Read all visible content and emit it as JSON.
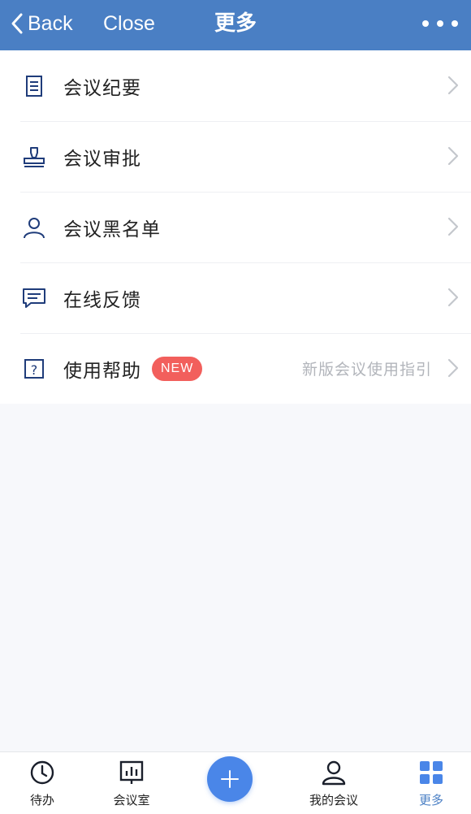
{
  "header": {
    "back_label": "Back",
    "close_label": "Close",
    "title": "更多",
    "more_icon": "more-dots-icon"
  },
  "menu": {
    "items": [
      {
        "label": "会议纪要",
        "icon": "document-icon"
      },
      {
        "label": "会议审批",
        "icon": "stamp-icon"
      },
      {
        "label": "会议黑名单",
        "icon": "user-icon"
      },
      {
        "label": "在线反馈",
        "icon": "chat-bubble-icon"
      },
      {
        "label": "使用帮助",
        "icon": "question-icon",
        "badge": "NEW",
        "hint": "新版会议使用指引"
      }
    ]
  },
  "tabbar": {
    "tabs": [
      {
        "label": "待办",
        "icon": "clock-icon"
      },
      {
        "label": "会议室",
        "icon": "board-chart-icon"
      },
      {
        "label": "",
        "icon": "plus-icon"
      },
      {
        "label": "我的会议",
        "icon": "person-icon"
      },
      {
        "label": "更多",
        "icon": "grid-icon",
        "active": true
      }
    ]
  },
  "colors": {
    "header_bg": "#4a7fc4",
    "accent": "#4a86e8",
    "badge_bg": "#f25f5c",
    "icon_navy": "#1f3c7a"
  }
}
